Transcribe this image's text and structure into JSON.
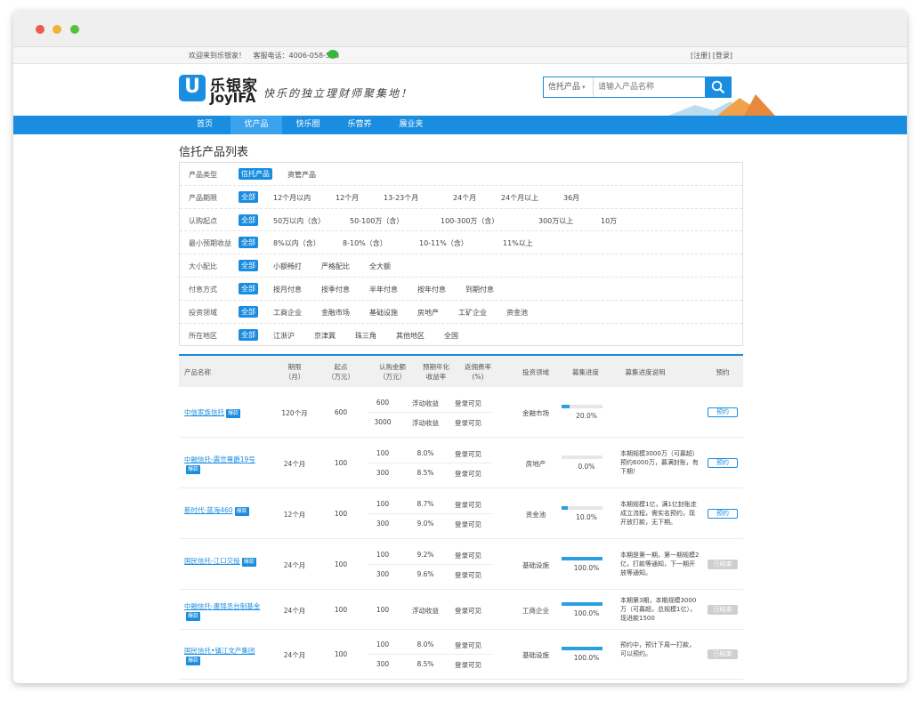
{
  "topbar": {
    "welcome": "欢迎来到乐银家！",
    "hotline": "客服电话：4006-058-588",
    "register": "[注册]",
    "login": "[登录]"
  },
  "brand": {
    "logo_cn": "乐银家",
    "logo_en": "JoyIFA",
    "slogan": "快乐的独立理财师聚集地！",
    "accent": "#1a8de0"
  },
  "search": {
    "category": "信托产品",
    "placeholder": "请输入产品名称"
  },
  "nav": [
    "首页",
    "优产品",
    "快乐圈",
    "乐营养",
    "展业夹"
  ],
  "nav_active": "优产品",
  "page_title": "信托产品列表",
  "filters": [
    {
      "label": "产品类型",
      "options": [
        "信托产品",
        "资管产品"
      ],
      "selected": "信托产品"
    },
    {
      "label": "产品期限",
      "options": [
        "全部",
        "12个月以内",
        "12个月",
        "13-23个月",
        "24个月",
        "24个月以上",
        "36月"
      ],
      "selected": "全部"
    },
    {
      "label": "认购起点",
      "options": [
        "全部",
        "50万以内（含）",
        "50-100万（含）",
        "100-300万（含）",
        "300万以上",
        "10万"
      ],
      "selected": "全部"
    },
    {
      "label": "最小预期收益",
      "options": [
        "全部",
        "8%以内（含）",
        "8-10%（含）",
        "10-11%（含）",
        "11%以上"
      ],
      "selected": "全部"
    },
    {
      "label": "大小配比",
      "options": [
        "全部",
        "小额畅打",
        "严格配比",
        "全大额"
      ],
      "selected": "全部"
    },
    {
      "label": "付息方式",
      "options": [
        "全部",
        "按月付息",
        "按季付息",
        "半年付息",
        "按年付息",
        "到期付息"
      ],
      "selected": "全部"
    },
    {
      "label": "投资领域",
      "options": [
        "全部",
        "工商企业",
        "金融市场",
        "基础设施",
        "房地产",
        "工矿企业",
        "资金池"
      ],
      "selected": "全部"
    },
    {
      "label": "所在地区",
      "options": [
        "全部",
        "江浙沪",
        "京津冀",
        "珠三角",
        "其他地区",
        "全国"
      ],
      "selected": "全部"
    }
  ],
  "table": {
    "headers": [
      "产品名称",
      "期限\n（月）",
      "起点\n（万元）",
      "认购金额\n（万元）",
      "预期年化\n收益率",
      "返佣费率\n(%)",
      "投资领域",
      "募集进度",
      "募集进度说明",
      "预约"
    ],
    "rows": [
      {
        "name": "中信家族信托",
        "badge": "爆款",
        "term": "120个月",
        "start": "600",
        "tiers": [
          {
            "amount": "600",
            "yield": "浮动收益",
            "fee": "登录可见"
          },
          {
            "amount": "3000",
            "yield": "浮动收益",
            "fee": "登录可见"
          }
        ],
        "field": "金融市场",
        "progress": 20.0,
        "progress_text": "20.0%",
        "desc": "",
        "action": "预约",
        "ended": false
      },
      {
        "name": "中融信托-震世尊爵19号",
        "badge": "爆款",
        "term": "24个月",
        "start": "100",
        "tiers": [
          {
            "amount": "100",
            "yield": "8.0%",
            "fee": "登录可见"
          },
          {
            "amount": "300",
            "yield": "8.5%",
            "fee": "登录可见"
          }
        ],
        "field": "房地产",
        "progress": 0.0,
        "progress_text": "0.0%",
        "desc": "本期规模3000万（可募超）预约6000万，募满封账，有下期！",
        "action": "预约",
        "ended": false
      },
      {
        "name": "新时代-蓝海460",
        "badge": "爆款",
        "term": "12个月",
        "start": "100",
        "tiers": [
          {
            "amount": "100",
            "yield": "8.7%",
            "fee": "登录可见"
          },
          {
            "amount": "300",
            "yield": "9.0%",
            "fee": "登录可见"
          }
        ],
        "field": "资金池",
        "progress": 10.0,
        "progress_text": "10.0%",
        "desc": "本期规模1亿，满1亿封账走成立流程，需实名预约，现开放打款，无下期。",
        "action": "预约",
        "ended": false
      },
      {
        "name": "国民信托-江口交投",
        "badge": "爆款",
        "term": "24个月",
        "start": "100",
        "tiers": [
          {
            "amount": "100",
            "yield": "9.2%",
            "fee": "登录可见"
          },
          {
            "amount": "300",
            "yield": "9.6%",
            "fee": "登录可见"
          }
        ],
        "field": "基础设施",
        "progress": 100.0,
        "progress_text": "100.0%",
        "desc": "本期是第一期，第一期规模2亿，打款等通知，下一期开放等通知。",
        "action": "已结束",
        "ended": true
      },
      {
        "name": "中融信托-惠锦丞台制基金",
        "badge": "爆款",
        "term": "24个月",
        "start": "100",
        "tiers": [
          {
            "amount": "100",
            "yield": "浮动收益",
            "fee": "登录可见"
          }
        ],
        "field": "工商企业",
        "progress": 100.0,
        "progress_text": "100.0%",
        "desc": "本期第3期，本期规模3000万（可募超，总规模1亿），现进款1500",
        "action": "已结束",
        "ended": true
      },
      {
        "name": "国民信托•镇江文产集团",
        "badge": "爆款",
        "term": "24个月",
        "start": "100",
        "tiers": [
          {
            "amount": "100",
            "yield": "8.0%",
            "fee": "登录可见"
          },
          {
            "amount": "300",
            "yield": "8.5%",
            "fee": "登录可见"
          }
        ],
        "field": "基础设施",
        "progress": 100.0,
        "progress_text": "100.0%",
        "desc": "预约中，预计下周一打款，可以预约。",
        "action": "已结束",
        "ended": true
      }
    ]
  }
}
